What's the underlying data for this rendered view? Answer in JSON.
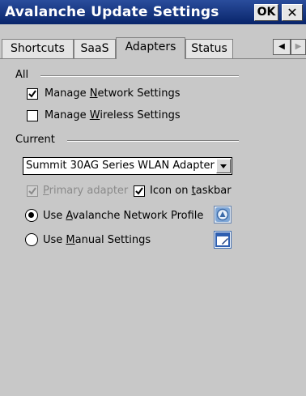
{
  "window": {
    "title": "Avalanche Update Settings",
    "ok_label": "OK",
    "close_label": "✕"
  },
  "tabs": [
    {
      "label": "Shortcuts",
      "active": false
    },
    {
      "label": "SaaS",
      "active": false
    },
    {
      "label": "Adapters",
      "active": true
    },
    {
      "label": "Status",
      "active": false
    }
  ],
  "tab_scroll": {
    "left": "◀",
    "right": "▶"
  },
  "all_group": {
    "label": "All",
    "manage_network": {
      "pre": "Manage ",
      "accel": "N",
      "post": "etwork Settings",
      "checked": true
    },
    "manage_wireless": {
      "pre": "Manage ",
      "accel": "W",
      "post": "ireless Settings",
      "checked": false
    }
  },
  "current_group": {
    "label": "Current",
    "adapter_select": {
      "value": "Summit 30AG Series WLAN Adapter"
    },
    "primary_adapter": {
      "pre": "",
      "accel": "P",
      "post": "rimary adapter",
      "checked": true,
      "disabled": true
    },
    "icon_on_taskbar": {
      "pre": "Icon on ",
      "accel": "t",
      "post": "askbar",
      "checked": true
    },
    "use_avalanche_profile": {
      "pre": "Use ",
      "accel": "A",
      "post": "valanche Network Profile",
      "selected": true
    },
    "use_manual_settings": {
      "pre": "Use ",
      "accel": "M",
      "post": "anual Settings",
      "selected": false
    }
  },
  "colors": {
    "titlebar": "#0a246a",
    "background": "#c8c8c8"
  }
}
